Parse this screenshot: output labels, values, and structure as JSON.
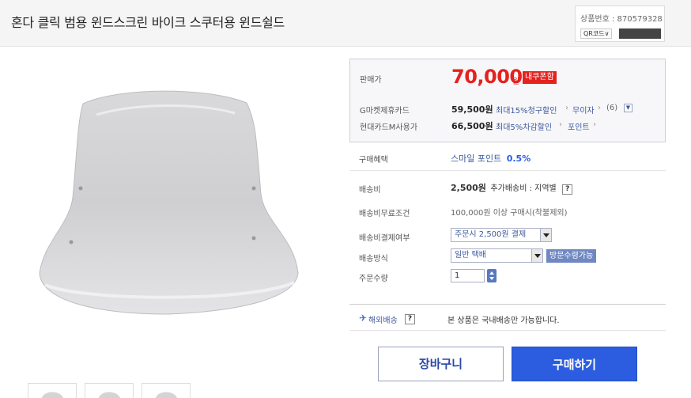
{
  "header": {
    "title": "혼다 클릭 범용 윈드스크린 바이크 스쿠터용 윈드쉴드",
    "product_code_label": "상품번호 : 870579328",
    "qr_label": "QR코드"
  },
  "price": {
    "label": "판매가",
    "amount": "70,000",
    "unit": "원",
    "badge": "내쿠폰함"
  },
  "cards": [
    {
      "label": "G마켓제휴카드",
      "price": "59,500원",
      "discount": "최대15%청구할인",
      "extra1": "무이자",
      "extra2": "(6)"
    },
    {
      "label": "현대카드M사용가",
      "price": "66,500원",
      "discount": "최대5%차감할인",
      "extra1": "포인트"
    }
  ],
  "benefit": {
    "label": "구매혜택",
    "value": "스마일 포인트",
    "percent": "0.5%"
  },
  "shipping": {
    "fee_label": "배송비",
    "fee_value": "2,500원",
    "fee_extra": "추가배송비 : 지역별",
    "free_label": "배송비무료조건",
    "free_value": "100,000원 이상 구매시(착불제외)",
    "pay_label": "배송비결제여부",
    "pay_value": "주문시 2,500원 결제",
    "method_label": "배송방식",
    "method_value": "일반 택배",
    "visit_badge": "방문수령가능"
  },
  "order": {
    "qty_label": "주문수량",
    "qty_value": "1"
  },
  "overseas": {
    "label": "해외배송",
    "text": "본 상품은 국내배송만 가능합니다."
  },
  "buttons": {
    "cart": "장바구니",
    "buy": "구매하기"
  },
  "colors": {
    "price_red": "#e4221e",
    "buy_blue": "#2c5de0",
    "link_blue": "#3d5a9c"
  }
}
